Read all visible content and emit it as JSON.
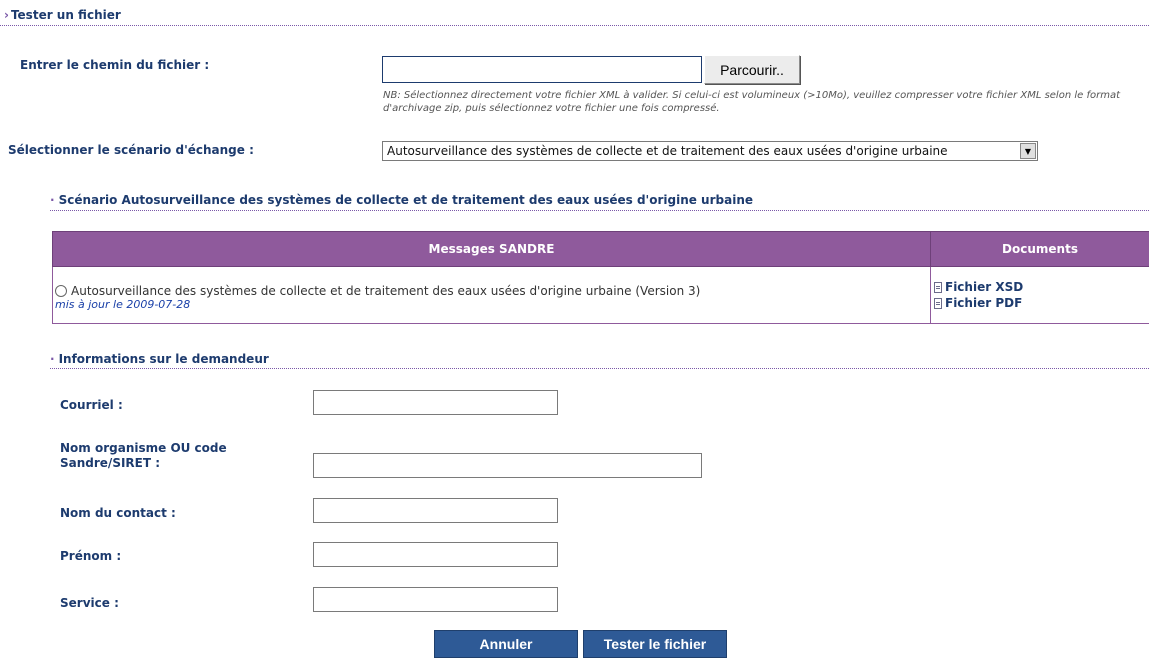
{
  "header": {
    "title": "Tester un fichier"
  },
  "file": {
    "label": "Entrer le chemin du fichier :",
    "value": "",
    "browse_label": "Parcourir..",
    "note": "NB: Sélectionnez directement votre fichier XML à valider. Si celui-ci est volumineux (>10Mo), veuillez compresser votre fichier XML selon le format d'archivage zip, puis sélectionnez votre fichier une fois compressé."
  },
  "scenario_select": {
    "label": "Sélectionner le scénario d'échange :",
    "selected": "Autosurveillance des systèmes de collecte et de traitement des eaux usées d'origine urbaine"
  },
  "scenario_section": {
    "title": "Scénario Autosurveillance des systèmes de collecte et de traitement des eaux usées d'origine urbaine",
    "columns": [
      "Messages SANDRE",
      "Documents"
    ],
    "rows": [
      {
        "message": "Autosurveillance des systèmes de collecte et de traitement des eaux usées d'origine urbaine (Version 3)",
        "updated": "mis à jour le 2009-07-28",
        "docs": [
          "Fichier XSD",
          "Fichier PDF"
        ]
      }
    ]
  },
  "requester": {
    "title": "Informations sur le demandeur",
    "fields": {
      "email": "Courriel :",
      "org_line1": "Nom organisme OU code",
      "org_line2": "Sandre/SIRET :",
      "contact": "Nom du contact :",
      "firstname": "Prénom :",
      "service": "Service :"
    }
  },
  "actions": {
    "cancel": "Annuler",
    "submit": "Tester le fichier"
  },
  "colors": {
    "accent": "#8f5a9c",
    "text": "#1d3b6e",
    "button": "#2e5a96"
  }
}
